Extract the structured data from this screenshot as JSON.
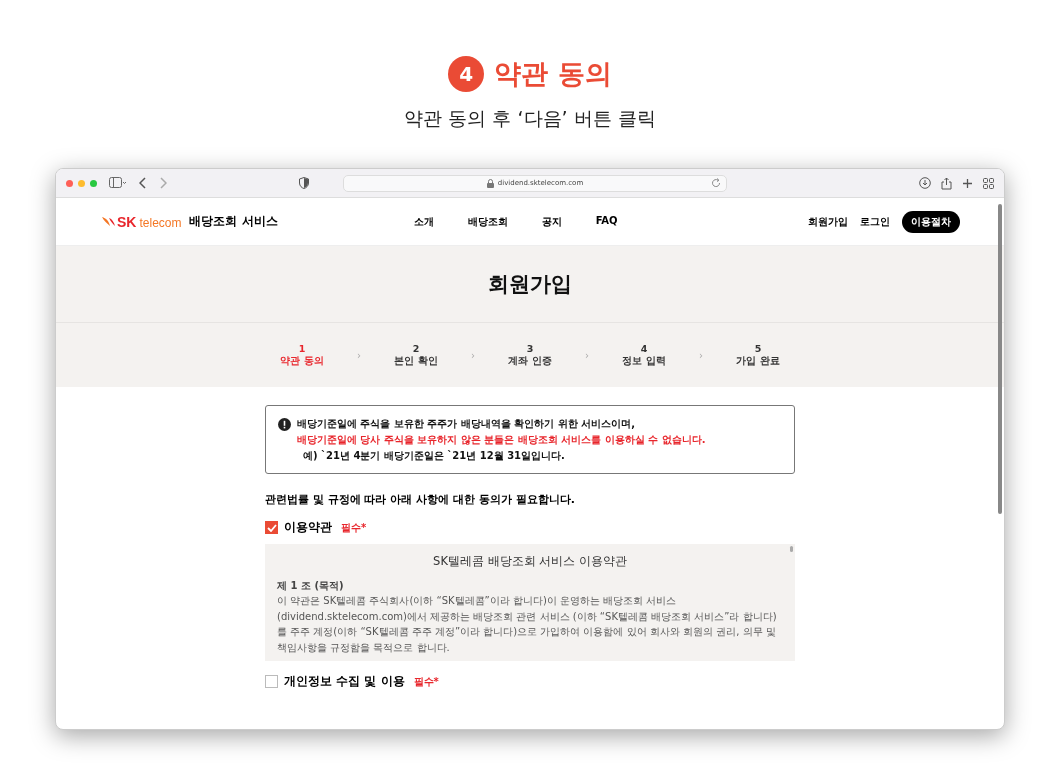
{
  "header": {
    "step_number": "4",
    "title": "약관 동의",
    "subtitle": "약관 동의 후 ‘다음’ 버튼 클릭"
  },
  "browser": {
    "url": "dividend.sktelecom.com"
  },
  "site_nav": {
    "logo_sk": "SK",
    "logo_telecom": "telecom",
    "service_name": "배당조회 서비스",
    "menu": [
      "소개",
      "배당조회",
      "공지",
      "FAQ"
    ],
    "links": [
      "회원가입",
      "로그인"
    ],
    "cta": "이용절차"
  },
  "page_title": "회원가입",
  "steps": [
    {
      "number": "1",
      "label": "약관 동의",
      "selected": true
    },
    {
      "number": "2",
      "label": "본인 확인",
      "selected": false
    },
    {
      "number": "3",
      "label": "계좌 인증",
      "selected": false
    },
    {
      "number": "4",
      "label": "정보 입력",
      "selected": false
    },
    {
      "number": "5",
      "label": "가입 완료",
      "selected": false
    }
  ],
  "step_separator": "›",
  "notice": {
    "line1": "배당기준일에 주식을 보유한 주주가 배당내역을 확인하기 위한 서비스이며,",
    "line2": "배당기준일에 당사 주식을 보유하지 않은 분들은 배당조회 서비스를 이용하실 수 없습니다.",
    "example": "예) `21년 4분기 배당기준일은 `21년 12월 31일입니다."
  },
  "intro": "관련법률 및 규정에 따라 아래 사항에 대한 동의가 필요합니다.",
  "agreements": [
    {
      "label": "이용약관",
      "required": "필수*",
      "checked": true,
      "doc_title": "SK텔레콤 배당조회 서비스 이용약관",
      "article": "제 1 조 (목적)",
      "body": "이 약관은 SK텔레콤 주식회사(이하 “SK텔레콤”이라 합니다)이 운영하는 배당조회 서비스 (dividend.sktelecom.com)에서 제공하는 배당조회 관련 서비스 (이하 “SK텔레콤 배당조회 서비스”라 합니다)를 주주 계정(이하 “SK텔레콤 주주 계정”이라 합니다)으로 가입하여 이용함에 있어 회사와 회원의 권리, 의무 및 책임사항을 규정함을 목적으로 합니다."
    },
    {
      "label": "개인정보 수집 및 이용",
      "required": "필수*",
      "checked": false
    }
  ]
}
